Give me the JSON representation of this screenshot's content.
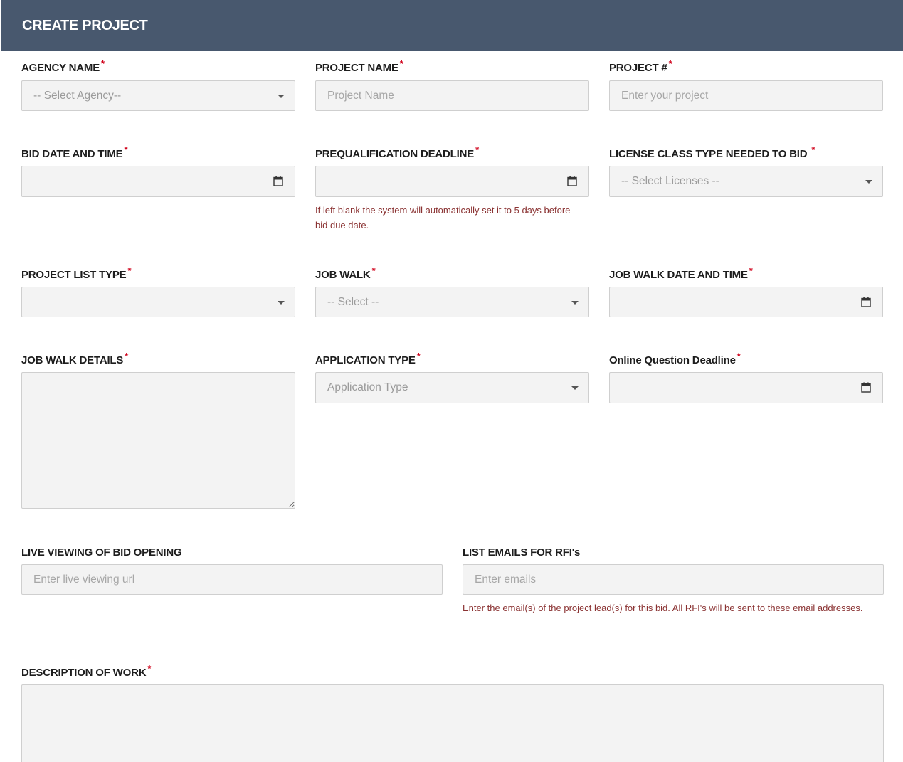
{
  "header": {
    "title": "CREATE PROJECT"
  },
  "required_mark": "*",
  "fields": {
    "agency": {
      "label": "AGENCY NAME",
      "placeholder": "-- Select Agency--"
    },
    "project_name": {
      "label": "PROJECT NAME",
      "placeholder": "Project Name"
    },
    "project_number": {
      "label": "PROJECT #",
      "placeholder": "Enter your project"
    },
    "bid_date": {
      "label": "BID DATE AND TIME",
      "value": ""
    },
    "prequal": {
      "label": "PREQUALIFICATION DEADLINE",
      "value": "",
      "help": "If left blank the system will automatically set it to 5 days before bid due date."
    },
    "license": {
      "label": "LICENSE CLASS TYPE NEEDED TO BID",
      "placeholder": "-- Select Licenses --"
    },
    "project_list_type": {
      "label": "PROJECT LIST TYPE",
      "placeholder": ""
    },
    "job_walk": {
      "label": "JOB WALK",
      "placeholder": "-- Select --"
    },
    "job_walk_date": {
      "label": "JOB WALK DATE AND TIME",
      "value": ""
    },
    "job_walk_details": {
      "label": "JOB WALK DETAILS",
      "value": ""
    },
    "application_type": {
      "label": "APPLICATION TYPE",
      "placeholder": "Application Type"
    },
    "online_question": {
      "label": "Online Question Deadline",
      "value": ""
    },
    "live_viewing": {
      "label": "LIVE VIEWING OF BID OPENING",
      "placeholder": "Enter live viewing url"
    },
    "rfi_emails": {
      "label": "LIST EMAILS FOR RFI's",
      "placeholder": "Enter emails",
      "help": "Enter the email(s) of the project lead(s) for this bid. All RFI's will be sent to these email addresses."
    },
    "description": {
      "label": "DESCRIPTION OF WORK",
      "value": ""
    }
  },
  "icons": {
    "calendar": "calendar-icon",
    "dropdown": "chevron-down-icon"
  },
  "colors": {
    "header_bg": "#48586e",
    "required": "#d0021b",
    "help_text": "#8a3232",
    "field_bg": "#f3f3f3"
  }
}
